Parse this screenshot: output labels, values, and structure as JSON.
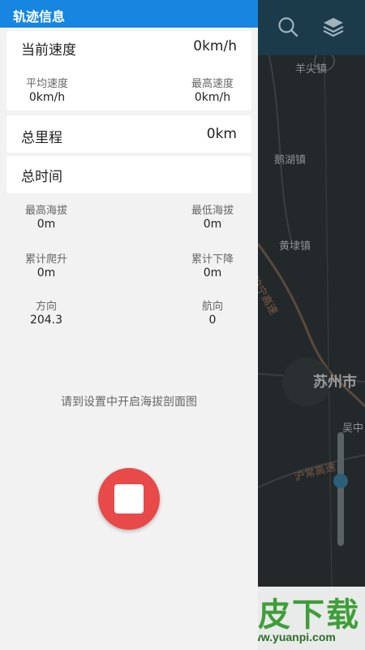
{
  "panel": {
    "title": "轨迹信息",
    "current_speed": {
      "label": "当前速度",
      "value": "0km/h"
    },
    "avg_speed": {
      "label": "平均速度",
      "value": "0km/h"
    },
    "max_speed": {
      "label": "最高速度",
      "value": "0km/h"
    },
    "total_distance": {
      "label": "总里程",
      "value": "0km"
    },
    "total_time": {
      "label": "总时间",
      "value": ""
    },
    "max_altitude": {
      "label": "最高海拔",
      "value": "0m"
    },
    "min_altitude": {
      "label": "最低海拔",
      "value": "0m"
    },
    "total_ascent": {
      "label": "累计爬升",
      "value": "0m"
    },
    "total_descent": {
      "label": "累计下降",
      "value": "0m"
    },
    "direction": {
      "label": "方向",
      "value": "204.3"
    },
    "heading": {
      "label": "航向",
      "value": "0"
    },
    "profile_hint": "请到设置中开启海拔剖面图",
    "stop_button": {
      "icon": "stop-icon"
    }
  },
  "map": {
    "labels": {
      "town1": "羊尖镇",
      "town2": "鹅湖镇",
      "town3": "黄埭镇",
      "road": "沪宁高速",
      "city": "苏州市",
      "district": "吴中",
      "road2": "沪常高速"
    },
    "icons": {
      "search": "search-icon",
      "layers": "layers-icon"
    },
    "zoom_level": 0.43
  },
  "watermark": {
    "brand": "元皮下载",
    "url": "www.yuanpi.com"
  },
  "colors": {
    "header": "#1686e0",
    "stop_button": "#e84a4a",
    "panel_bg": "#f2f2f2",
    "map_bg": "#23282b"
  }
}
